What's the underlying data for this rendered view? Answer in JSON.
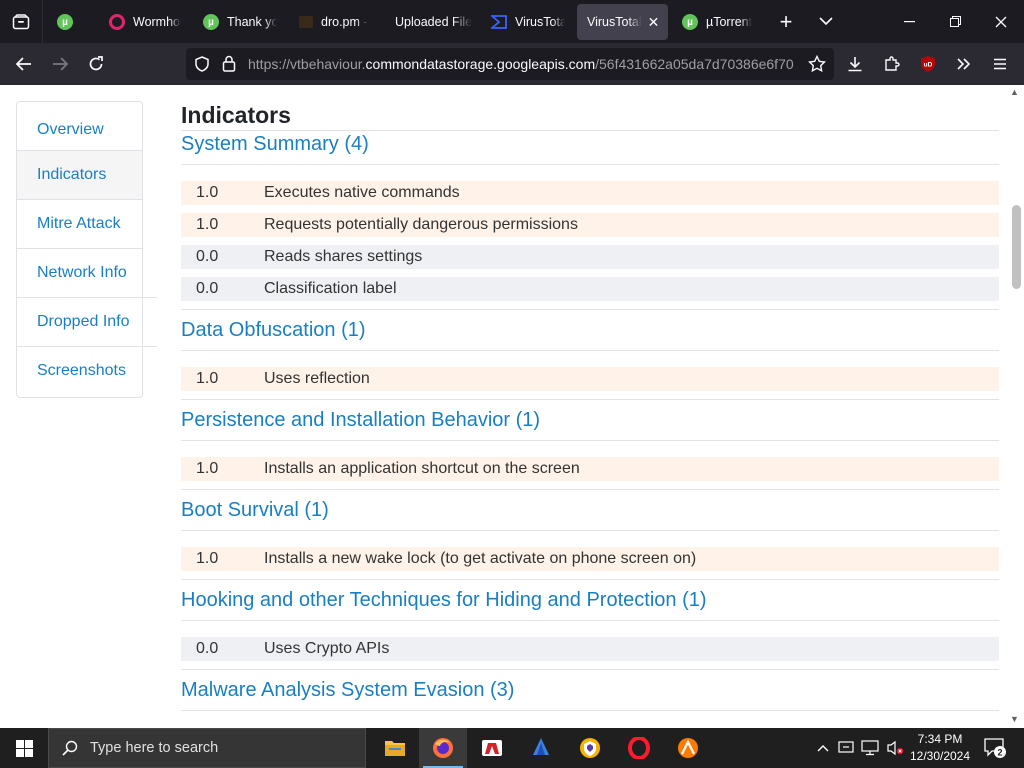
{
  "browser": {
    "tabs": [
      {
        "title": "",
        "icon": "utorrent-icon"
      },
      {
        "title": "Wormhole",
        "icon": "wormhole-icon"
      },
      {
        "title": "Thank you",
        "icon": "utorrent-icon"
      },
      {
        "title": "dro.pm -",
        "icon": "dro-icon"
      },
      {
        "title": "Uploaded File",
        "icon": ""
      },
      {
        "title": "VirusTotal",
        "icon": "virustotal-icon"
      },
      {
        "title": "VirusTotal",
        "icon": ""
      },
      {
        "title": "µTorrent",
        "icon": "utorrent-icon"
      }
    ],
    "url_prefix": "https://vtbehaviour.",
    "url_host": "commondatastorage.googleapis.com",
    "url_path": "/56f431662a05da7d70386e6f70",
    "extension_badge": "uD"
  },
  "sidebar": {
    "items": [
      {
        "label": "Overview"
      },
      {
        "label": "Indicators"
      },
      {
        "label": "Mitre Attack"
      },
      {
        "label": "Network Info"
      },
      {
        "label": "Dropped Info"
      },
      {
        "label": "Screenshots"
      }
    ]
  },
  "main": {
    "title": "Indicators",
    "sections": [
      {
        "heading": "System Summary (4)",
        "rows": [
          {
            "score": "1.0",
            "desc": "Executes native commands"
          },
          {
            "score": "1.0",
            "desc": "Requests potentially dangerous permissions"
          },
          {
            "score": "0.0",
            "desc": "Reads shares settings"
          },
          {
            "score": "0.0",
            "desc": "Classification label"
          }
        ]
      },
      {
        "heading": "Data Obfuscation (1)",
        "rows": [
          {
            "score": "1.0",
            "desc": "Uses reflection"
          }
        ]
      },
      {
        "heading": "Persistence and Installation Behavior (1)",
        "rows": [
          {
            "score": "1.0",
            "desc": "Installs an application shortcut on the screen"
          }
        ]
      },
      {
        "heading": "Boot Survival (1)",
        "rows": [
          {
            "score": "1.0",
            "desc": "Installs a new wake lock (to get activate on phone screen on)"
          }
        ]
      },
      {
        "heading": "Hooking and other Techniques for Hiding and Protection (1)",
        "rows": [
          {
            "score": "0.0",
            "desc": "Uses Crypto APIs"
          }
        ]
      },
      {
        "heading": "Malware Analysis System Evasion (3)",
        "rows": []
      }
    ],
    "colors": {
      "link": "#1a7fc1",
      "high_row": "#fff2e8",
      "low_row": "#eff0f4"
    }
  },
  "taskbar": {
    "search_placeholder": "Type here to search",
    "time": "7:34 PM",
    "date": "12/30/2024",
    "notification_count": "2"
  }
}
